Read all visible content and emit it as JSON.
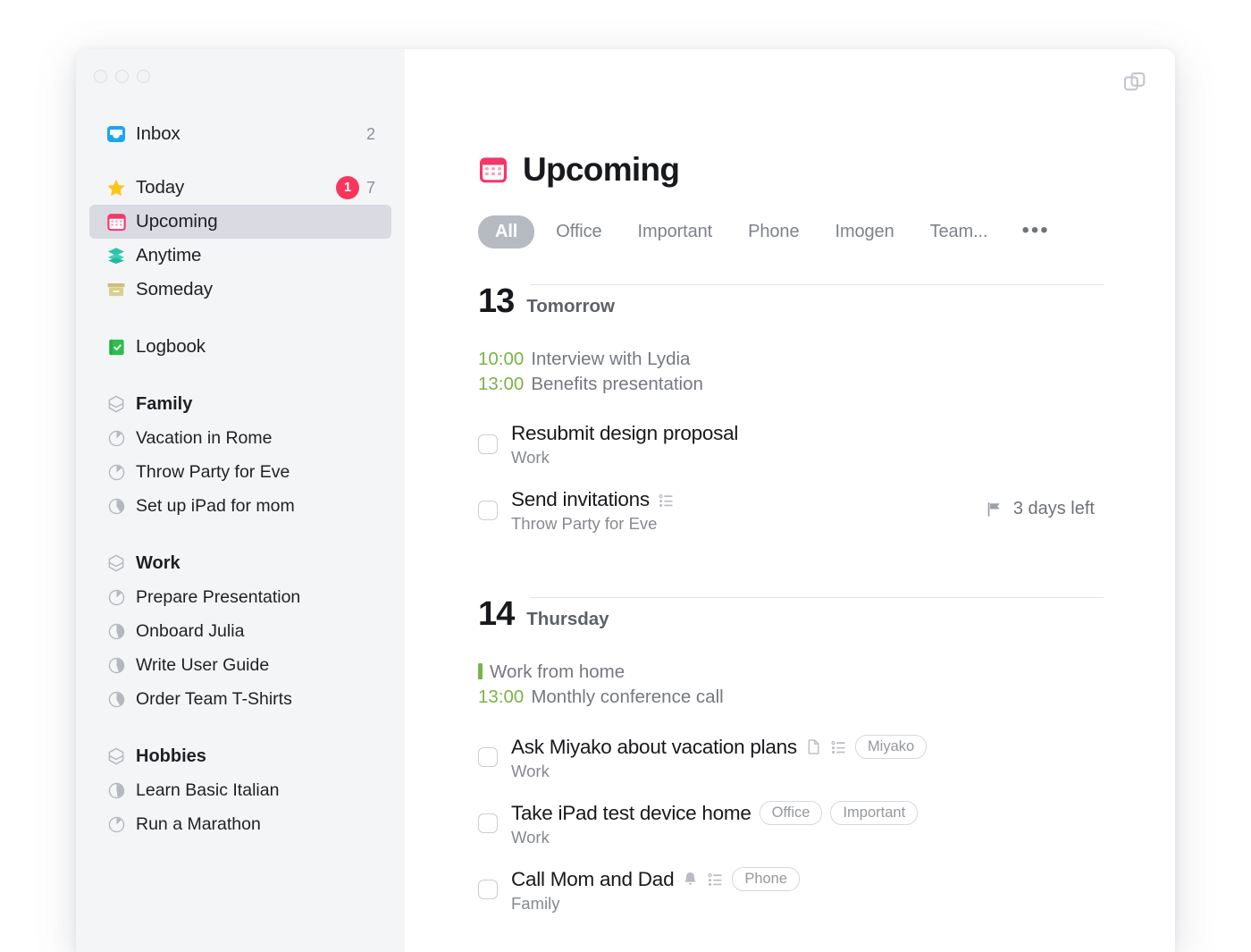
{
  "window": {
    "traffic_lights": [
      "close",
      "minimize",
      "zoom"
    ],
    "copy_icon": "copy-windows-icon"
  },
  "sidebar": {
    "smart_lists": [
      {
        "label": "Inbox",
        "icon": "inbox-tray-icon",
        "count": "2",
        "badge": null,
        "selected": false
      },
      {
        "label": "Today",
        "icon": "star-icon",
        "count": "7",
        "badge": "1",
        "selected": false
      },
      {
        "label": "Upcoming",
        "icon": "calendar-icon",
        "count": null,
        "badge": null,
        "selected": true
      },
      {
        "label": "Anytime",
        "icon": "layers-icon",
        "count": null,
        "badge": null,
        "selected": false
      },
      {
        "label": "Someday",
        "icon": "box-icon",
        "count": null,
        "badge": null,
        "selected": false
      }
    ],
    "logbook": {
      "label": "Logbook",
      "icon": "logbook-book-icon"
    },
    "areas": [
      {
        "label": "Family",
        "icon": "area-hexagon-icon",
        "projects": [
          {
            "label": "Vacation in Rome",
            "icon": "project-progress-icon",
            "progress": 12
          },
          {
            "label": "Throw Party for Eve",
            "icon": "project-progress-icon",
            "progress": 14
          },
          {
            "label": "Set up iPad for mom",
            "icon": "project-progress-icon",
            "progress": 42
          }
        ]
      },
      {
        "label": "Work",
        "icon": "area-hexagon-icon",
        "projects": [
          {
            "label": "Prepare Presentation",
            "icon": "project-progress-icon",
            "progress": 13
          },
          {
            "label": "Onboard Julia",
            "icon": "project-progress-icon",
            "progress": 45
          },
          {
            "label": "Write User Guide",
            "icon": "project-progress-icon",
            "progress": 45
          },
          {
            "label": "Order Team T-Shirts",
            "icon": "project-progress-icon",
            "progress": 40
          }
        ]
      },
      {
        "label": "Hobbies",
        "icon": "area-hexagon-icon",
        "projects": [
          {
            "label": "Learn Basic Italian",
            "icon": "project-progress-icon",
            "progress": 48
          },
          {
            "label": "Run a Marathon",
            "icon": "project-progress-icon",
            "progress": 12
          }
        ]
      }
    ]
  },
  "main": {
    "title": "Upcoming",
    "title_icon": "calendar-icon",
    "filters": [
      {
        "label": "All",
        "active": true
      },
      {
        "label": "Office",
        "active": false
      },
      {
        "label": "Important",
        "active": false
      },
      {
        "label": "Phone",
        "active": false
      },
      {
        "label": "Imogen",
        "active": false
      },
      {
        "label": "Team...",
        "active": false
      }
    ],
    "filters_more": "•••",
    "days": [
      {
        "number": "13",
        "name": "Tomorrow",
        "events": [
          {
            "time": "10:00",
            "title": "Interview with Lydia",
            "allday": false
          },
          {
            "time": "13:00",
            "title": "Benefits presentation",
            "allday": false
          }
        ],
        "todos": [
          {
            "title": "Resubmit design proposal",
            "project": "Work",
            "icons": [],
            "tags": [],
            "deadline": null
          },
          {
            "title": "Send invitations",
            "project": "Throw Party for Eve",
            "icons": [
              "checklist-icon"
            ],
            "tags": [],
            "deadline": "3 days left",
            "deadline_icon": "flag-icon"
          }
        ]
      },
      {
        "number": "14",
        "name": "Thursday",
        "events": [
          {
            "time": null,
            "title": "Work from home",
            "allday": true
          },
          {
            "time": "13:00",
            "title": "Monthly conference call",
            "allday": false
          }
        ],
        "todos": [
          {
            "title": "Ask Miyako about vacation plans",
            "project": "Work",
            "icons": [
              "note-icon",
              "checklist-icon"
            ],
            "tags": [
              "Miyako"
            ],
            "deadline": null
          },
          {
            "title": "Take iPad test device home",
            "project": "Work",
            "icons": [],
            "tags": [
              "Office",
              "Important"
            ],
            "deadline": null
          },
          {
            "title": "Call Mom and Dad",
            "project": "Family",
            "icons": [
              "bell-icon",
              "checklist-icon"
            ],
            "tags": [
              "Phone"
            ],
            "deadline": null
          }
        ]
      }
    ]
  },
  "colors": {
    "accent_pink": "#f8365e",
    "event_green": "#79b448",
    "sidebar_bg": "#f4f5f7",
    "selected_bg": "#d9dae2",
    "filter_active_bg": "#b6bac1"
  }
}
